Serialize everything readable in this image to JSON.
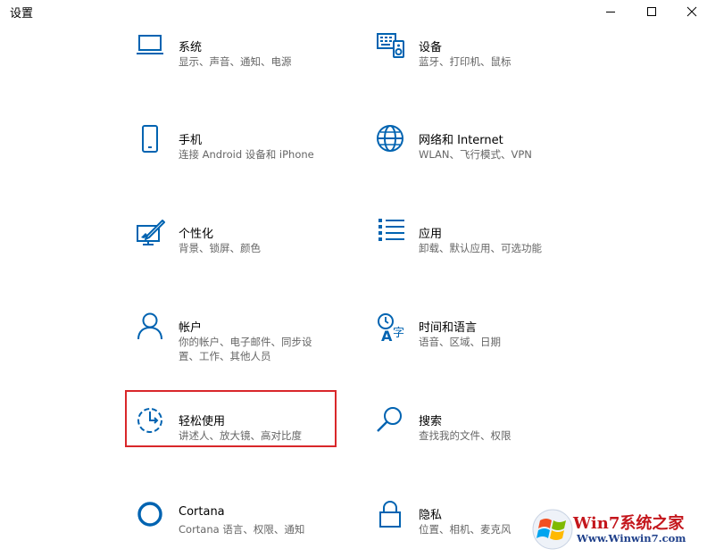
{
  "window": {
    "title": "设置"
  },
  "tiles": [
    {
      "title": "系统",
      "desc": "显示、声音、通知、电源",
      "icon": "laptop-icon"
    },
    {
      "title": "设备",
      "desc": "蓝牙、打印机、鼠标",
      "icon": "devices-icon"
    },
    {
      "title": "手机",
      "desc": "连接 Android 设备和 iPhone",
      "icon": "phone-icon"
    },
    {
      "title": "网络和 Internet",
      "desc": "WLAN、飞行模式、VPN",
      "icon": "globe-icon"
    },
    {
      "title": "个性化",
      "desc": "背景、锁屏、颜色",
      "icon": "personalization-icon"
    },
    {
      "title": "应用",
      "desc": "卸载、默认应用、可选功能",
      "icon": "apps-list-icon"
    },
    {
      "title": "帐户",
      "desc": "你的帐户、电子邮件、同步设置、工作、其他人员",
      "icon": "person-icon"
    },
    {
      "title": "时间和语言",
      "desc": "语音、区域、日期",
      "icon": "time-language-icon"
    },
    {
      "title": "轻松使用",
      "desc": "讲述人、放大镜、高对比度",
      "icon": "ease-of-access-icon"
    },
    {
      "title": "搜索",
      "desc": "查找我的文件、权限",
      "icon": "search-icon"
    },
    {
      "title": "Cortana",
      "desc": "Cortana 语言、权限、通知",
      "icon": "cortana-icon"
    },
    {
      "title": "隐私",
      "desc": "位置、相机、麦克风",
      "icon": "lock-icon"
    }
  ],
  "highlight_tile": "轻松使用",
  "watermark": {
    "brand": "Win7系统之家",
    "url": "Www.Winwin7.com"
  },
  "colors": {
    "accent": "#0063b1",
    "highlight_border": "#d9272a",
    "desc_text": "#666666"
  }
}
